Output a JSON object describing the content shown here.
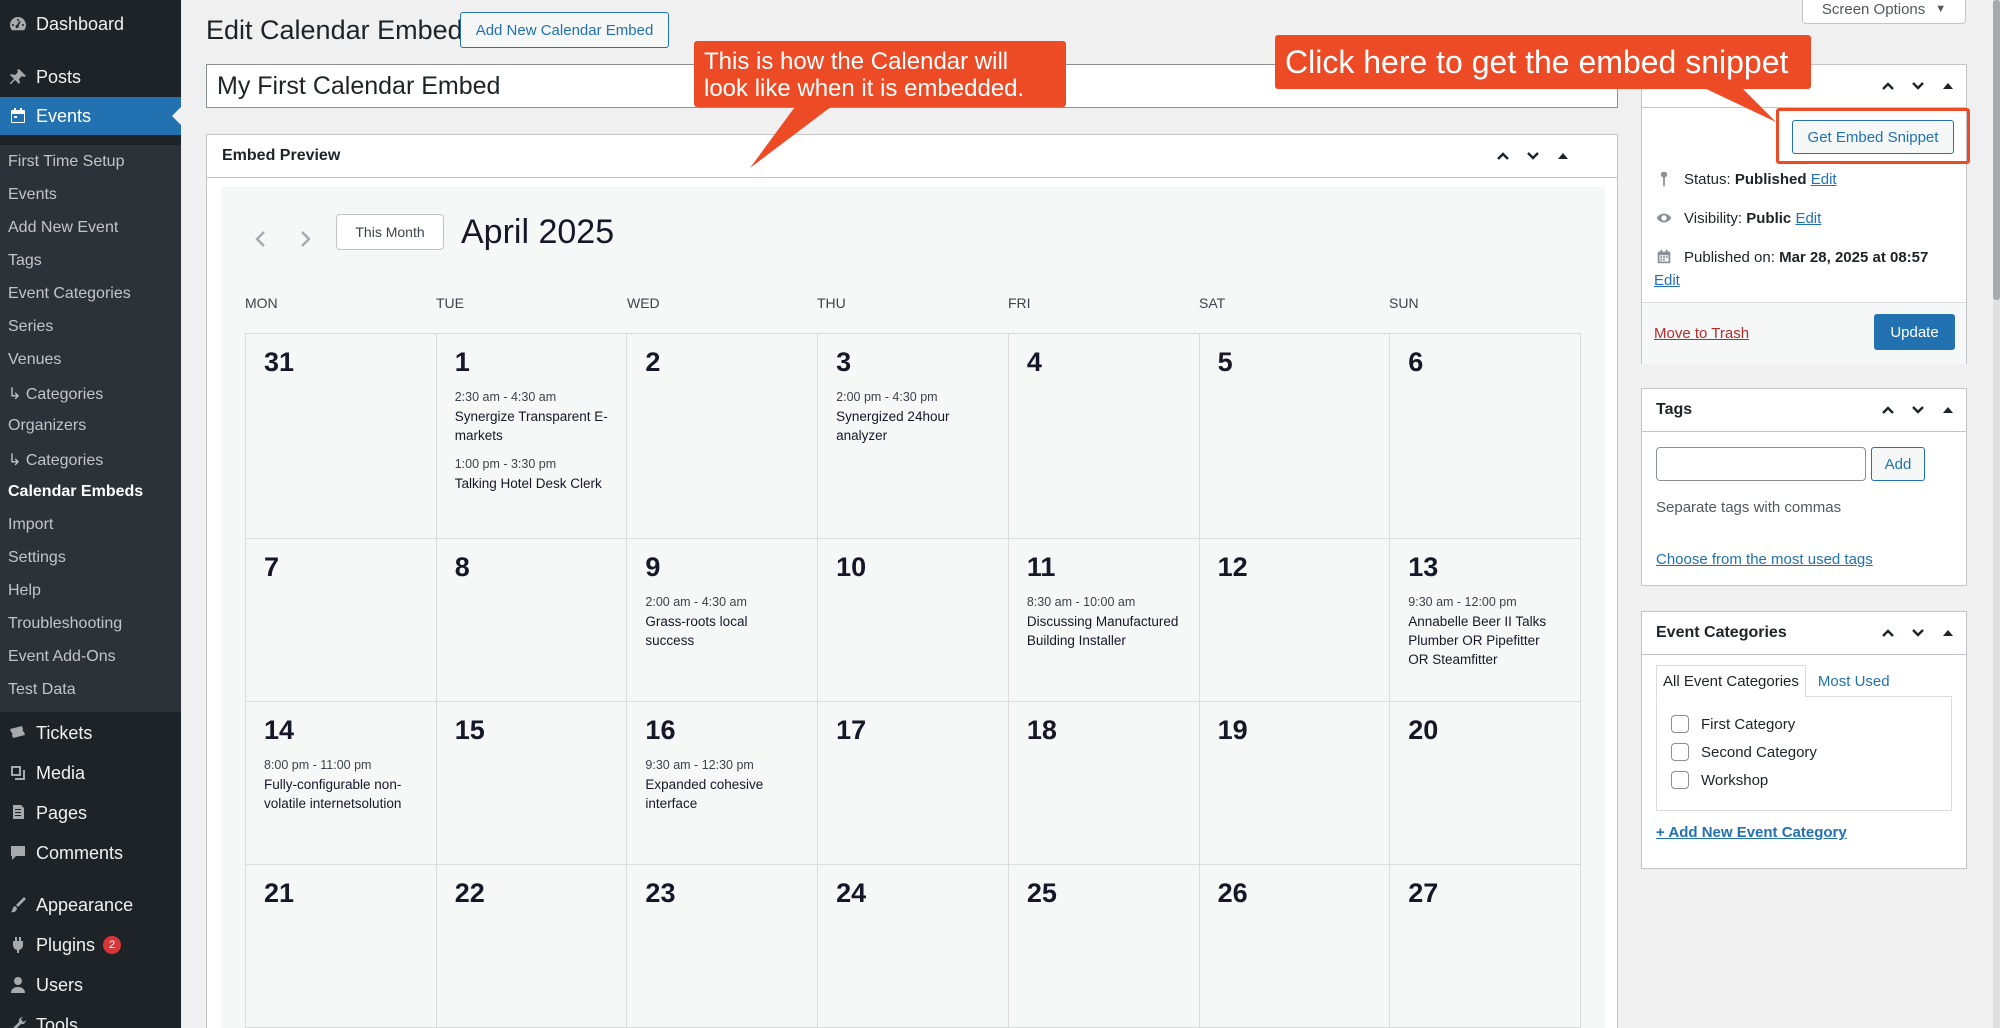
{
  "sidebar": {
    "top_items": [
      {
        "label": "Dashboard",
        "icon": "dashboard-icon"
      },
      {
        "label": "Posts",
        "icon": "pushpin-icon"
      },
      {
        "label": "Events",
        "icon": "calendar-icon"
      }
    ],
    "events_submenu": [
      "First Time Setup",
      "Events",
      "Add New Event",
      "Tags",
      "Event Categories",
      "Series",
      "Venues",
      "↳ Categories",
      "Organizers",
      "↳ Categories",
      "Calendar Embeds",
      "Import",
      "Settings",
      "Help",
      "Troubleshooting",
      "Event Add-Ons",
      "Test Data"
    ],
    "bottom_items": [
      {
        "label": "Tickets",
        "icon": "ticket-icon"
      },
      {
        "label": "Media",
        "icon": "media-icon"
      },
      {
        "label": "Pages",
        "icon": "pages-icon"
      },
      {
        "label": "Comments",
        "icon": "comments-icon"
      },
      {
        "label": "Appearance",
        "icon": "brush-icon"
      },
      {
        "label": "Plugins",
        "icon": "plugin-icon",
        "badge": "2"
      },
      {
        "label": "Users",
        "icon": "users-icon"
      },
      {
        "label": "Tools",
        "icon": "tools-icon"
      }
    ]
  },
  "header": {
    "screen_options": "Screen Options",
    "page_title": "Edit Calendar Embed",
    "add_new_label": "Add New Calendar Embed"
  },
  "title_input": {
    "value": "My First Calendar Embed"
  },
  "preview": {
    "box_title": "Embed Preview",
    "this_month_label": "This Month",
    "month_title": "April 2025",
    "weekdays": [
      "MON",
      "TUE",
      "WED",
      "THU",
      "FRI",
      "SAT",
      "SUN"
    ],
    "days": [
      {
        "num": "31",
        "events": []
      },
      {
        "num": "1",
        "events": [
          {
            "time": "2:30 am - 4:30 am",
            "title": "Synergize Transparent E-markets"
          },
          {
            "time": "1:00 pm - 3:30 pm",
            "title": "Talking Hotel Desk Clerk"
          }
        ]
      },
      {
        "num": "2",
        "events": []
      },
      {
        "num": "3",
        "events": [
          {
            "time": "2:00 pm - 4:30 pm",
            "title": "Synergized 24hour analyzer"
          }
        ]
      },
      {
        "num": "4",
        "events": []
      },
      {
        "num": "5",
        "events": []
      },
      {
        "num": "6",
        "events": []
      },
      {
        "num": "7",
        "events": []
      },
      {
        "num": "8",
        "events": []
      },
      {
        "num": "9",
        "events": [
          {
            "time": "2:00 am - 4:30 am",
            "title": "Grass-roots local success"
          }
        ]
      },
      {
        "num": "10",
        "events": []
      },
      {
        "num": "11",
        "events": [
          {
            "time": "8:30 am - 10:00 am",
            "title": "Discussing Manufactured Building Installer"
          }
        ]
      },
      {
        "num": "12",
        "events": []
      },
      {
        "num": "13",
        "events": [
          {
            "time": "9:30 am - 12:00 pm",
            "title": "Annabelle Beer II Talks Plumber OR Pipefitter OR Steamfitter"
          }
        ]
      },
      {
        "num": "14",
        "events": [
          {
            "time": "8:00 pm - 11:00 pm",
            "title": "Fully-configurable non-volatile internetsolution"
          }
        ]
      },
      {
        "num": "15",
        "events": []
      },
      {
        "num": "16",
        "events": [
          {
            "time": "9:30 am - 12:30 pm",
            "title": "Expanded cohesive interface"
          }
        ]
      },
      {
        "num": "17",
        "events": []
      },
      {
        "num": "18",
        "events": []
      },
      {
        "num": "19",
        "events": []
      },
      {
        "num": "20",
        "events": []
      },
      {
        "num": "21",
        "events": []
      },
      {
        "num": "22",
        "events": []
      },
      {
        "num": "23",
        "events": []
      },
      {
        "num": "24",
        "events": []
      },
      {
        "num": "25",
        "events": []
      },
      {
        "num": "26",
        "events": []
      },
      {
        "num": "27",
        "events": []
      }
    ]
  },
  "publish": {
    "get_snippet_label": "Get Embed Snippet",
    "status_label": "Status:",
    "status_value": "Published",
    "visibility_label": "Visibility:",
    "visibility_value": "Public",
    "published_on_label": "Published on:",
    "published_on_value": "Mar 28, 2025 at 08:57",
    "edit_label": "Edit",
    "trash_label": "Move to Trash",
    "update_label": "Update"
  },
  "tags_box": {
    "title": "Tags",
    "input_value": "",
    "add_label": "Add",
    "help": "Separate tags with commas",
    "choose_link": "Choose from the most used tags"
  },
  "categories_box": {
    "title": "Event Categories",
    "tab_all": "All Event Categories",
    "tab_most_used": "Most Used",
    "items": [
      "First Category",
      "Second Category",
      "Workshop"
    ],
    "add_link": "+ Add New Event Category"
  },
  "annotations": {
    "preview_note": "This is how the Calendar will look like when it is embedded.",
    "snippet_note": "Click here to get the embed snippet",
    "color": "#ed4a26"
  },
  "colors": {
    "sidebar_bg": "#1d2327",
    "submenu_bg": "#2c3338",
    "accent": "#2271b1",
    "danger": "#b32d2e"
  }
}
